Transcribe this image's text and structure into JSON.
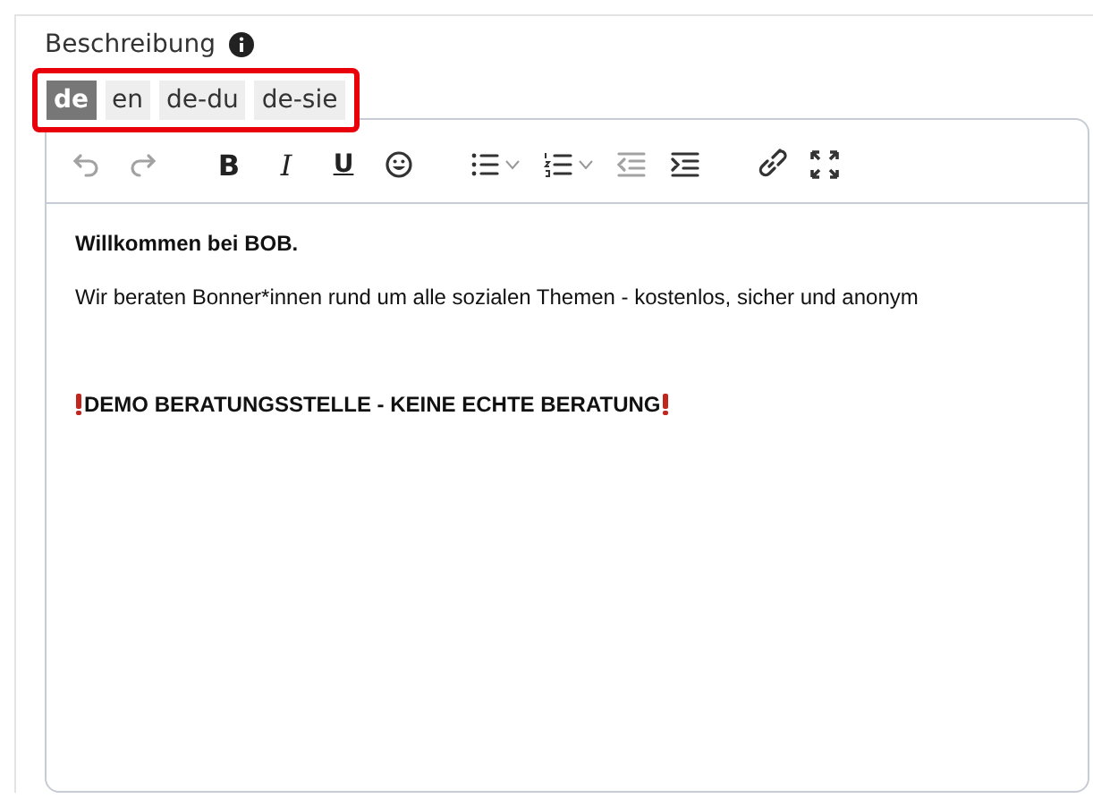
{
  "field": {
    "label": "Beschreibung",
    "info": true
  },
  "language_tabs": [
    {
      "label": "de",
      "selected": true
    },
    {
      "label": "en",
      "selected": false
    },
    {
      "label": "de-du",
      "selected": false
    },
    {
      "label": "de-sie",
      "selected": false
    }
  ],
  "toolbar": [
    [
      {
        "kind": "undo",
        "disabled": true
      },
      {
        "kind": "redo",
        "disabled": true
      }
    ],
    [
      {
        "kind": "bold",
        "label": "B"
      },
      {
        "kind": "italic",
        "label": "I"
      },
      {
        "kind": "underline",
        "label": "U"
      },
      {
        "kind": "emoji"
      }
    ],
    [
      {
        "kind": "bullets"
      },
      {
        "kind": "numbered"
      },
      {
        "kind": "outdent",
        "disabled": true
      },
      {
        "kind": "indent"
      }
    ],
    [
      {
        "kind": "link"
      },
      {
        "kind": "fullscreen"
      }
    ]
  ],
  "content": [
    {
      "kind": "heading",
      "text": "Willkommen bei BOB."
    },
    {
      "kind": "paragraph",
      "text": "Wir beraten Bonner*innen rund um alle sozialen Themen - kostenlos, sicher und anonym"
    },
    {
      "kind": "blank"
    },
    {
      "kind": "alert",
      "text": "DEMO BERATUNGSSTELLE - KEINE ECHTE BERATUNG"
    }
  ]
}
